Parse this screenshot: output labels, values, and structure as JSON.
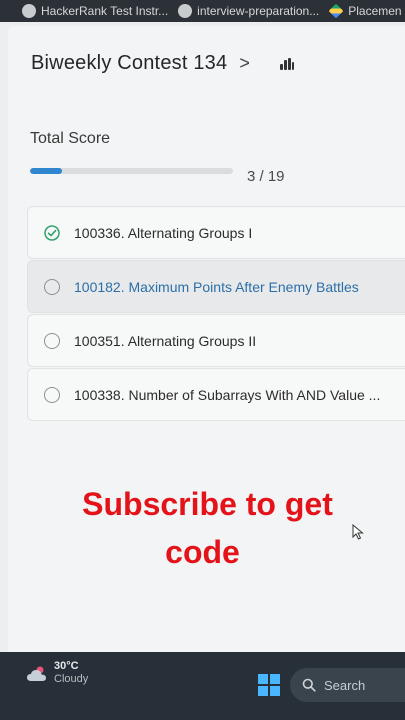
{
  "browser": {
    "tabs": [
      {
        "label": "HackerRank Test Instr..."
      },
      {
        "label": "interview-preparation..."
      },
      {
        "label": "Placemen"
      }
    ]
  },
  "contest": {
    "title": "Biweekly Contest 134",
    "chevron": ">",
    "total_score_label": "Total Score",
    "progress_text": "3 / 19",
    "progress_fraction": 0.158
  },
  "problems": [
    {
      "label": "100336. Alternating Groups I",
      "status": "solved"
    },
    {
      "label": "100182. Maximum Points After Enemy Battles",
      "status": "unsolved",
      "highlighted": true
    },
    {
      "label": "100351. Alternating Groups II",
      "status": "unsolved"
    },
    {
      "label": "100338. Number of Subarrays With AND Value ...",
      "status": "unsolved"
    }
  ],
  "overlay": {
    "line1": "Subscribe to get",
    "line2": "code",
    "color": "#e4131a"
  },
  "taskbar": {
    "temperature": "30°C",
    "condition": "Cloudy",
    "search_label": "Search"
  },
  "colors": {
    "accent": "#2f86cf",
    "success": "#2fa36b",
    "link": "#2c6fa8"
  }
}
